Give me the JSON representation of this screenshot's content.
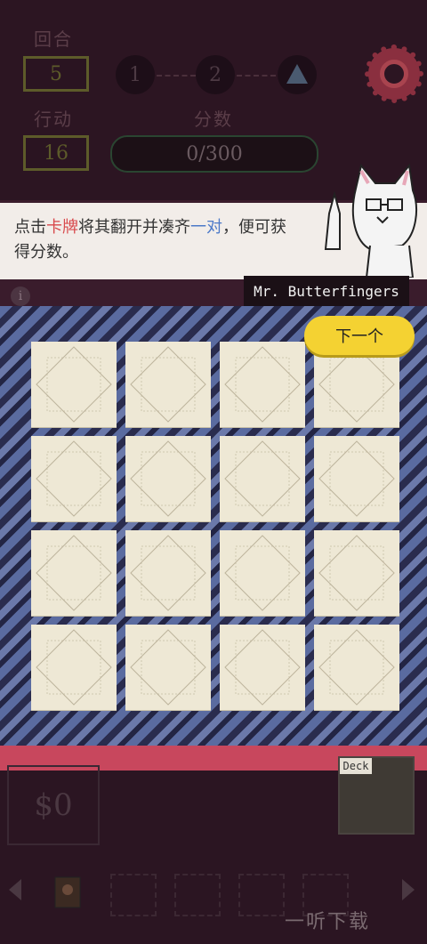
{
  "hud": {
    "round_label": "回合",
    "round_value": "5",
    "actions_label": "行动",
    "actions_value": "16",
    "score_label": "分数",
    "score_value": "0/300",
    "stages": [
      "1",
      "2"
    ]
  },
  "dialog": {
    "text_parts": [
      "点击",
      "卡牌",
      "将其翻开并凑齐",
      "一对",
      "，便可获得分数。"
    ],
    "speaker": "Mr. Butterfingers",
    "info": "i"
  },
  "board": {
    "next_button": "下一个",
    "rows": 4,
    "cols": 4
  },
  "bottom": {
    "money": "$0",
    "deck_label": "Deck"
  },
  "watermark": "一听下载",
  "colors": {
    "next_button": "#f4d232",
    "card": "#eee8d5",
    "highlight_red": "#d8484b",
    "highlight_blue": "#4c79c8",
    "band": "#c8475d"
  }
}
